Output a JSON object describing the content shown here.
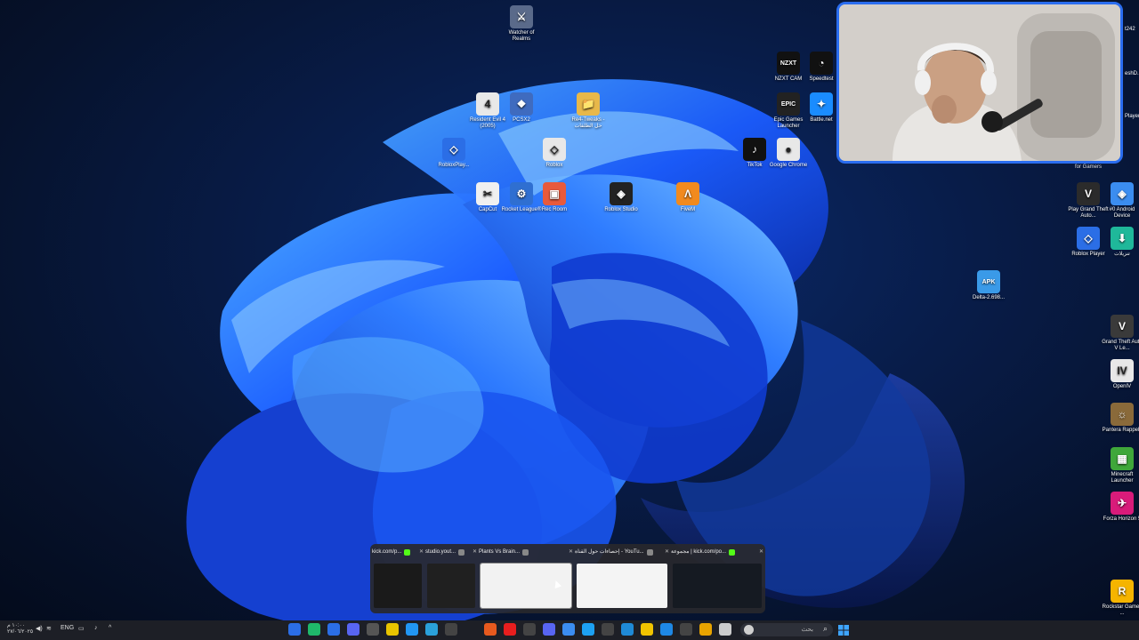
{
  "desktop_icons": [
    {
      "label": "Watcher of Realms",
      "glyph": "⚔",
      "color": "#5a6a8a"
    },
    {
      "label": "NZXT CAM",
      "glyph": "NZXT",
      "color": "#111111"
    },
    {
      "label": "Speedtest",
      "glyph": "◔",
      "color": "#111111"
    },
    {
      "label": "Resident Evil 4 (2005)",
      "glyph": "4",
      "color": "#e8e8e8"
    },
    {
      "label": "PCSX2",
      "glyph": "❖",
      "color": "#3f6bbf"
    },
    {
      "label": "Re4-Tweaks - حل الطلقات",
      "glyph": "📁",
      "color": "#e8b84a"
    },
    {
      "label": "Epic Games Launcher",
      "glyph": "EPIC",
      "color": "#222222"
    },
    {
      "label": "Battle.net",
      "glyph": "✦",
      "color": "#1a8cff"
    },
    {
      "label": "RobloxPlay...",
      "glyph": "◇",
      "color": "#2b6ee6"
    },
    {
      "label": "Roblox",
      "glyph": "◇",
      "color": "#e8e8e8"
    },
    {
      "label": "TikTok",
      "glyph": "♪",
      "color": "#111111"
    },
    {
      "label": "Google Chrome",
      "glyph": "●",
      "color": "#e8e8e8"
    },
    {
      "label": "CapCut",
      "glyph": "✂",
      "color": "#f0f0f0"
    },
    {
      "label": "Rocket League®",
      "glyph": "⚙",
      "color": "#2f6fd1"
    },
    {
      "label": "Rec Room",
      "glyph": "▣",
      "color": "#e85a3c"
    },
    {
      "label": "Roblox Studio",
      "glyph": "◈",
      "color": "#222222"
    },
    {
      "label": "FiveM",
      "glyph": "Λ",
      "color": "#f28a1e"
    },
    {
      "label": "Play Grand Theft Auto...",
      "glyph": "V",
      "color": "#2b2b2b"
    },
    {
      "label": "#0 Android Device",
      "glyph": "◈",
      "color": "#3b8df0"
    },
    {
      "label": "Roblox Player",
      "glyph": "◇",
      "color": "#2b6ee6"
    },
    {
      "label": "تنزيلات",
      "glyph": "⬇",
      "color": "#1fb89a"
    },
    {
      "label": "Delta-2.698...",
      "glyph": "APK",
      "color": "#3a9ae8"
    },
    {
      "label": "Grand Theft Auto V Le...",
      "glyph": "V",
      "color": "#3a3a3a"
    },
    {
      "label": "OpenIV",
      "glyph": "IV",
      "color": "#e8e8e8"
    },
    {
      "label": "Pantera Rappelz",
      "glyph": "☼",
      "color": "#8a6a3a"
    },
    {
      "label": "Minecraft Launcher",
      "glyph": "▦",
      "color": "#3fa73a"
    },
    {
      "label": "Forza Horizon 5",
      "glyph": "✈",
      "color": "#d81b7a"
    },
    {
      "label": "Rockstar Games ...",
      "glyph": "R",
      "color": "#f5b400"
    }
  ],
  "webcam": {
    "caption": "for Gamers"
  },
  "right_edge_labels": [
    "t242",
    "eshD...",
    "Player"
  ],
  "task_previews": [
    {
      "title": "kick.com/p...",
      "badge_color": "#53fc18"
    },
    {
      "title": "studio.yout...",
      "badge_color": "#888888"
    },
    {
      "title": "Plants Vs Brain...",
      "badge_color": "#888888"
    },
    {
      "title": "إحصاءات حول القناة - YouTu...",
      "badge_color": "#888888"
    },
    {
      "title": "مجموعة | kick.com/po...",
      "badge_color": "#53fc18"
    }
  ],
  "taskbar": {
    "tray_lang": "ENG",
    "clock_time": "١٠:٠٠ م",
    "clock_date": "٢٧/٠٦/٢٠٢٥",
    "search_placeholder": "بحث"
  },
  "colors": {
    "accent": "#2a6df0",
    "taskbar": "#1d1f26",
    "kick_green": "#53fc18"
  }
}
